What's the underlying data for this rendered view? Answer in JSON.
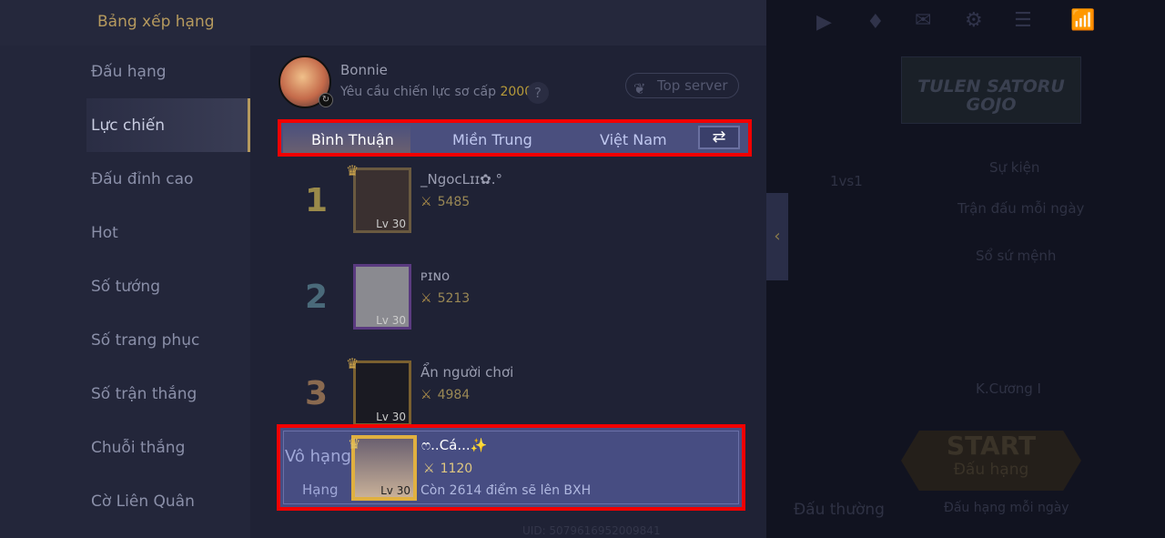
{
  "header": {
    "title": "Bảng xếp hạng"
  },
  "sidebar": {
    "selected": "Lực chiến",
    "items": [
      {
        "label": "Đấu hạng"
      },
      {
        "label": "Lực chiến"
      },
      {
        "label": "Đấu đỉnh cao"
      },
      {
        "label": "Hot"
      },
      {
        "label": "Số tướng"
      },
      {
        "label": "Số trang phục"
      },
      {
        "label": "Số trận thắng"
      },
      {
        "label": "Chuỗi thắng"
      },
      {
        "label": "Cờ Liên Quân"
      }
    ]
  },
  "hero": {
    "name": "Bonnie",
    "requirement": "Yêu cầu chiến lực sơ cấp",
    "requirement_value": "2000",
    "help": "?",
    "top_server": "Top server"
  },
  "tabs": {
    "active": "Bình Thuận",
    "items": [
      {
        "label": "Bình Thuận"
      },
      {
        "label": "Miền Trung"
      },
      {
        "label": "Việt Nam"
      }
    ],
    "swap_icon": "⇄"
  },
  "ranking": [
    {
      "rank": "1",
      "name": "_NgocLɪɪ✿.°",
      "score": "5485",
      "level": "Lv 30",
      "rank_color": "#9a8a4a"
    },
    {
      "rank": "2",
      "name": "ᴘɪɴᴏ",
      "score": "5213",
      "level": "Lv 30",
      "rank_color": "#4a6a7a"
    },
    {
      "rank": "3",
      "name": "Ẩn người chơi",
      "score": "4984",
      "level": "Lv 30",
      "rank_color": "#8a6a50"
    }
  ],
  "me": {
    "rank_text": "Vô hạng",
    "rank_label": "Hạng",
    "name": "ෆ..Cá...✨",
    "score": "1120",
    "level": "Lv 30",
    "note": "Còn 2614 điểm sẽ lên BXH"
  },
  "uid": "UID: 5079616952009841",
  "background": {
    "banner": "TULEN SATORU GOJO",
    "mode": "1vs1",
    "events": [
      {
        "label": "Sự kiện"
      },
      {
        "label": "Trận đấu mỗi ngày"
      },
      {
        "label": "Sổ sứ mệnh"
      }
    ],
    "rank_tier": "K.Cương I",
    "start": "START",
    "start_mode": "Đấu hạng",
    "normal": "Đấu thường",
    "daily": "Đấu hạng mỗi ngày"
  }
}
